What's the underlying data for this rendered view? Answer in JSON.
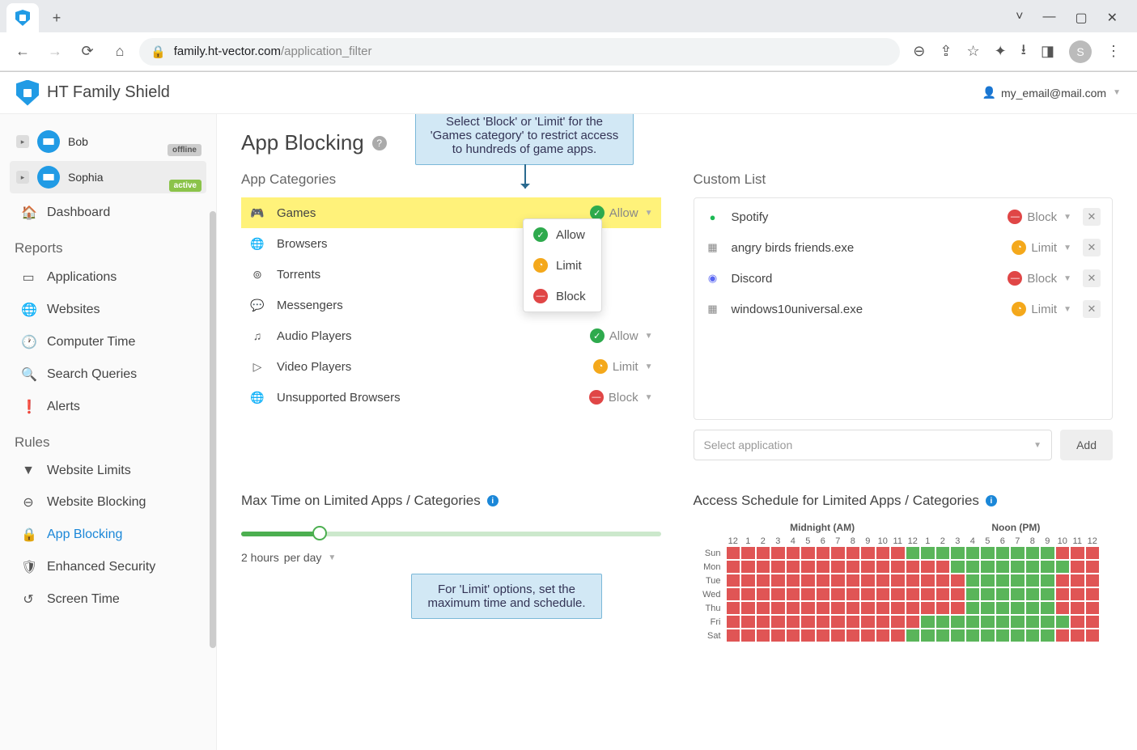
{
  "browser": {
    "url_host": "family.ht-vector.com",
    "url_path": "/application_filter",
    "avatar_letter": "S"
  },
  "app": {
    "title": "HT Family Shield",
    "user_email": "my_email@mail.com"
  },
  "profiles": [
    {
      "name": "Bob",
      "status": "offline",
      "selected": false
    },
    {
      "name": "Sophia",
      "status": "active",
      "selected": true
    }
  ],
  "nav": {
    "dashboard": "Dashboard",
    "reports_heading": "Reports",
    "applications": "Applications",
    "websites": "Websites",
    "computer_time": "Computer Time",
    "search_queries": "Search Queries",
    "alerts": "Alerts",
    "rules_heading": "Rules",
    "website_limits": "Website Limits",
    "website_blocking": "Website Blocking",
    "app_blocking": "App Blocking",
    "enhanced_security": "Enhanced Security",
    "screen_time": "Screen Time"
  },
  "page": {
    "title": "App Blocking",
    "categories_title": "App Categories",
    "custom_title": "Custom List",
    "max_time_title": "Max Time on Limited Apps / Categories",
    "schedule_title": "Access Schedule for Limited Apps / Categories",
    "select_placeholder": "Select application",
    "add_label": "Add",
    "slider_value": "2 hours",
    "slider_unit": "per day"
  },
  "status_labels": {
    "allow": "Allow",
    "limit": "Limit",
    "block": "Block"
  },
  "categories": [
    {
      "icon": "gamepad",
      "label": "Games",
      "status": "allow",
      "highlight": true,
      "open": true
    },
    {
      "icon": "globe",
      "label": "Browsers"
    },
    {
      "icon": "torrent",
      "label": "Torrents"
    },
    {
      "icon": "messenger",
      "label": "Messengers"
    },
    {
      "icon": "audio",
      "label": "Audio Players",
      "status": "allow"
    },
    {
      "icon": "video",
      "label": "Video Players",
      "status": "limit"
    },
    {
      "icon": "globe",
      "label": "Unsupported Browsers",
      "status": "block"
    }
  ],
  "custom_list": [
    {
      "icon": "spotify",
      "label": "Spotify",
      "status": "block"
    },
    {
      "icon": "exe",
      "label": "angry birds friends.exe",
      "status": "limit"
    },
    {
      "icon": "discord",
      "label": "Discord",
      "status": "block"
    },
    {
      "icon": "exe",
      "label": "windows10universal.exe",
      "status": "limit"
    }
  ],
  "callouts": {
    "c1": "Select 'Block' or 'Limit' for the 'Games category' to restrict access to hundreds of game apps.",
    "c2": "For 'Limit' options, set the maximum time and schedule."
  },
  "schedule": {
    "midnight_label": "Midnight (AM)",
    "noon_label": "Noon (PM)",
    "hours": [
      "12",
      "1",
      "2",
      "3",
      "4",
      "5",
      "6",
      "7",
      "8",
      "9",
      "10",
      "11",
      "12",
      "1",
      "2",
      "3",
      "4",
      "5",
      "6",
      "7",
      "8",
      "9",
      "10",
      "11",
      "12"
    ],
    "days": [
      "Sun",
      "Mon",
      "Tue",
      "Wed",
      "Thu",
      "Fri",
      "Sat"
    ],
    "grid": [
      "rrrrrrrrrrrrggggggggggrrr",
      "rrrrrrrrrrrrrrrggggggggrr",
      "rrrrrrrrrrrrrrrrggggggrrr",
      "rrrrrrrrrrrrrrrrggggggrrr",
      "rrrrrrrrrrrrrrrrggggggrrr",
      "rrrrrrrrrrrrrggggggggggrr",
      "rrrrrrrrrrrrggggggggggrrr"
    ]
  }
}
